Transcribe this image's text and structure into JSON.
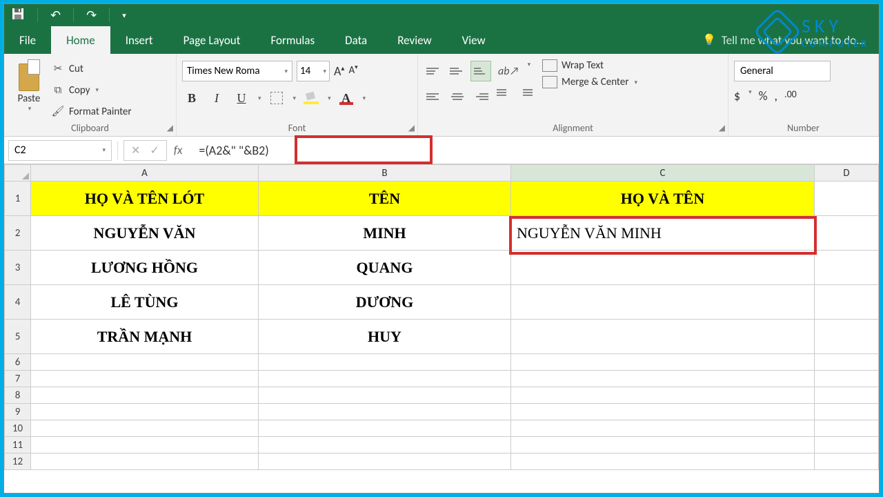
{
  "qat": {
    "save": "💾",
    "undo": "↶",
    "redo": "↷"
  },
  "tabs": {
    "file": "File",
    "items": [
      "Home",
      "Insert",
      "Page Layout",
      "Formulas",
      "Data",
      "Review",
      "View"
    ],
    "active": "Home",
    "tellme": "Tell me what you want to do..."
  },
  "ribbon": {
    "clipboard": {
      "paste": "Paste",
      "cut": "Cut",
      "copy": "Copy",
      "painter": "Format Painter",
      "label": "Clipboard"
    },
    "font": {
      "name": "Times New Roma",
      "size": "14",
      "label": "Font"
    },
    "alignment": {
      "wrap": "Wrap Text",
      "merge": "Merge & Center",
      "label": "Alignment"
    },
    "number": {
      "format": "General",
      "label": "Number"
    }
  },
  "formula_bar": {
    "namebox": "C2",
    "formula": "=(A2&\" \"&B2)"
  },
  "columns": [
    "A",
    "B",
    "C",
    "D"
  ],
  "header_row": [
    "HỌ VÀ TÊN LÓT",
    "TÊN",
    "HỌ VÀ TÊN",
    ""
  ],
  "rows": [
    {
      "a": "NGUYỄN VĂN",
      "b": "MINH",
      "c": "NGUYỄN VĂN  MINH"
    },
    {
      "a": "LƯƠNG HỒNG",
      "b": "QUANG",
      "c": ""
    },
    {
      "a": "LÊ TÙNG",
      "b": "DƯƠNG",
      "c": ""
    },
    {
      "a": "TRẦN MẠNH",
      "b": "HUY",
      "c": ""
    }
  ],
  "logo": {
    "line1": "SKY",
    "line2": "COMPUTER"
  }
}
